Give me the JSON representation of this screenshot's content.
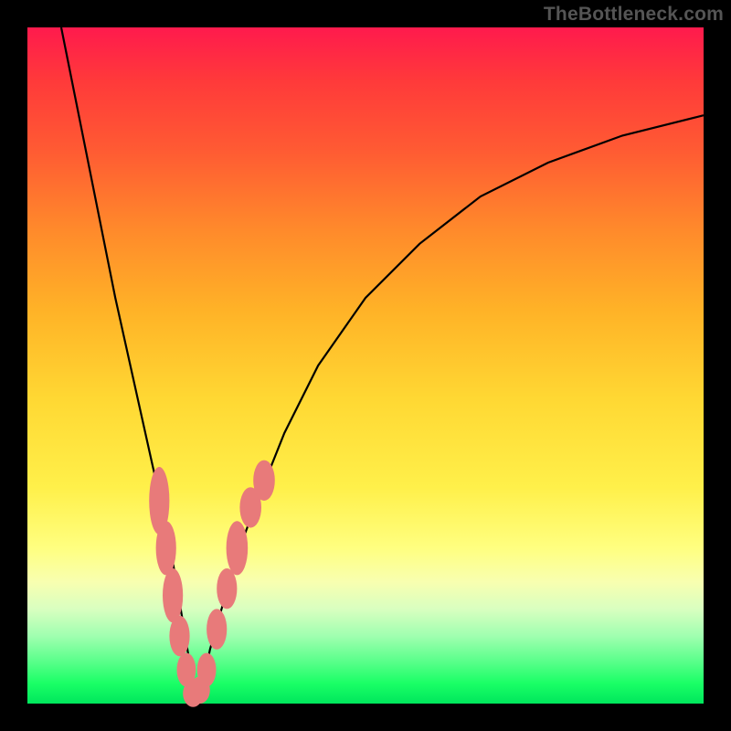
{
  "watermark": "TheBottleneck.com",
  "colors": {
    "frame": "#000000",
    "gradient_top": "#ff1a4d",
    "gradient_bottom": "#00e65c",
    "curve": "#000000",
    "marker_fill": "#e87a7a",
    "marker_stroke": "#b24646"
  },
  "chart_data": {
    "type": "line",
    "title": "",
    "xlabel": "",
    "ylabel": "",
    "xlim": [
      0,
      100
    ],
    "ylim": [
      0,
      100
    ],
    "grid": false,
    "legend": false,
    "note": "x is normalized horizontal position (0=left edge of plot, 100=right). y is normalized vertical position (0=bottom, 100=top). Values are estimated from pixel positions; no axis ticks are shown in the source image.",
    "series": [
      {
        "name": "bottleneck-curve",
        "x": [
          5,
          7,
          9,
          11,
          13,
          15,
          17,
          19,
          21,
          22,
          23,
          24,
          25,
          26,
          27,
          29,
          31,
          34,
          38,
          43,
          50,
          58,
          67,
          77,
          88,
          100
        ],
        "y": [
          100,
          90,
          80,
          70,
          60,
          51,
          42,
          33,
          24,
          18,
          12,
          6,
          1,
          3,
          8,
          15,
          22,
          30,
          40,
          50,
          60,
          68,
          75,
          80,
          84,
          87
        ]
      }
    ],
    "markers": [
      {
        "x": 19.5,
        "y": 30,
        "rx": 1.5,
        "ry": 5
      },
      {
        "x": 20.5,
        "y": 23,
        "rx": 1.5,
        "ry": 4
      },
      {
        "x": 21.5,
        "y": 16,
        "rx": 1.5,
        "ry": 4
      },
      {
        "x": 22.5,
        "y": 10,
        "rx": 1.5,
        "ry": 3
      },
      {
        "x": 23.5,
        "y": 5,
        "rx": 1.4,
        "ry": 2.5
      },
      {
        "x": 24.5,
        "y": 1.5,
        "rx": 1.5,
        "ry": 2
      },
      {
        "x": 25.5,
        "y": 2,
        "rx": 1.5,
        "ry": 2
      },
      {
        "x": 26.5,
        "y": 5,
        "rx": 1.4,
        "ry": 2.5
      },
      {
        "x": 28.0,
        "y": 11,
        "rx": 1.5,
        "ry": 3
      },
      {
        "x": 29.5,
        "y": 17,
        "rx": 1.5,
        "ry": 3
      },
      {
        "x": 31.0,
        "y": 23,
        "rx": 1.6,
        "ry": 4
      },
      {
        "x": 33.0,
        "y": 29,
        "rx": 1.6,
        "ry": 3
      },
      {
        "x": 35.0,
        "y": 33,
        "rx": 1.6,
        "ry": 3
      }
    ]
  }
}
